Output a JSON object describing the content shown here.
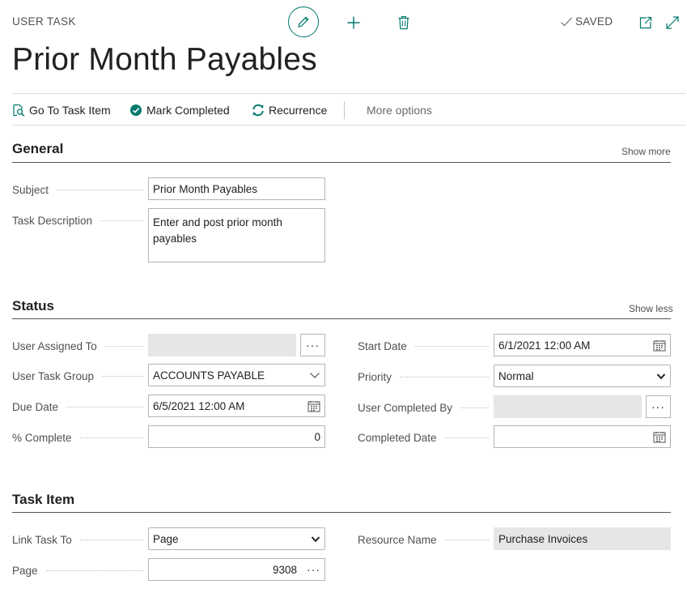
{
  "header": {
    "caption": "USER TASK",
    "title": "Prior Month Payables",
    "saved_label": "SAVED"
  },
  "actions": {
    "go_to_task_item": "Go To Task Item",
    "mark_completed": "Mark Completed",
    "recurrence": "Recurrence",
    "more_options": "More options"
  },
  "general": {
    "title": "General",
    "toggle": "Show more",
    "subject_label": "Subject",
    "subject_value": "Prior Month Payables",
    "description_label": "Task Description",
    "description_value": "Enter and post prior month payables"
  },
  "status": {
    "title": "Status",
    "toggle": "Show less",
    "user_assigned_label": "User Assigned To",
    "user_assigned_value": "",
    "user_task_group_label": "User Task Group",
    "user_task_group_value": "ACCOUNTS PAYABLE",
    "due_date_label": "Due Date",
    "due_date_value": "6/5/2021 12:00 AM",
    "percent_complete_label": "% Complete",
    "percent_complete_value": "0",
    "start_date_label": "Start Date",
    "start_date_value": "6/1/2021 12:00 AM",
    "priority_label": "Priority",
    "priority_value": "Normal",
    "user_completed_label": "User Completed By",
    "user_completed_value": "",
    "completed_date_label": "Completed Date",
    "completed_date_value": ""
  },
  "task_item": {
    "title": "Task Item",
    "link_task_to_label": "Link Task To",
    "link_task_to_value": "Page",
    "page_label": "Page",
    "page_value": "9308",
    "resource_name_label": "Resource Name",
    "resource_name_value": "Purchase Invoices"
  },
  "colors": {
    "accent": "#00796b",
    "text": "#212121",
    "muted": "#505050",
    "readonly_bg": "#e6e6e6"
  },
  "icons": {
    "edit": "pencil-icon",
    "new": "plus-icon",
    "delete": "trash-icon",
    "saved": "checkmark-icon",
    "popout": "open-in-new-window-icon",
    "expand": "expand-icon",
    "go_to": "search-document-icon",
    "mark": "check-circle-icon",
    "recurrence": "refresh-icon",
    "calendar": "calendar-icon",
    "dropdown": "chevron-down-icon"
  }
}
